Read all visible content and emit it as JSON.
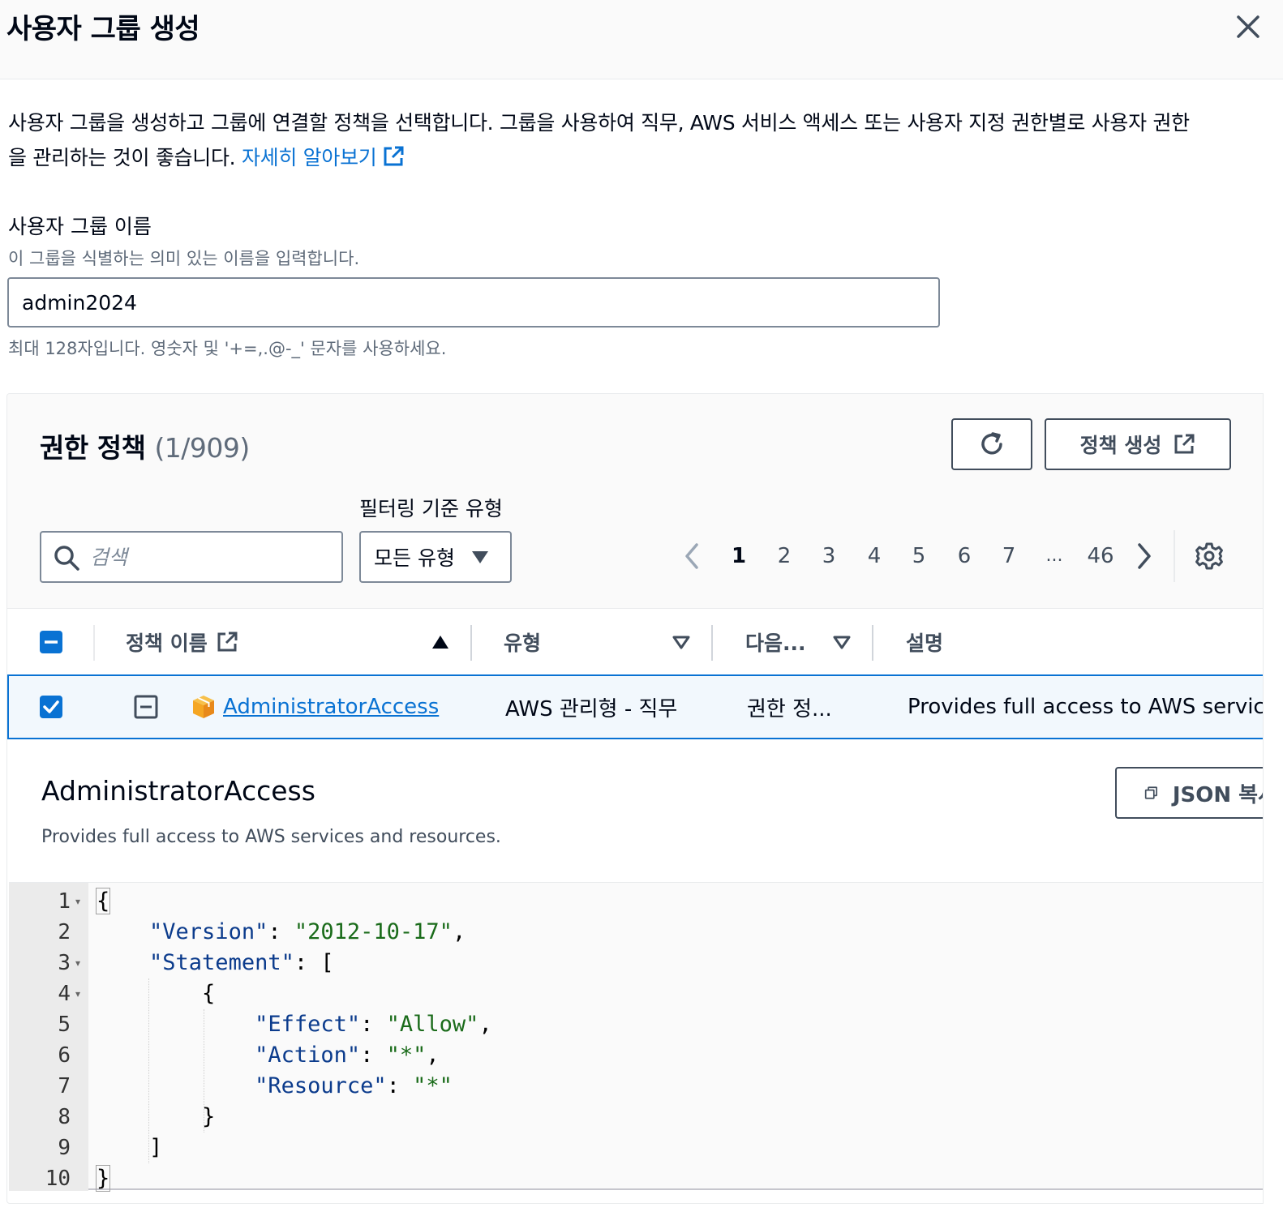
{
  "modal": {
    "title": "사용자 그룹 생성",
    "intro_line1": "사용자 그룹을 생성하고 그룹에 연결할 정책을 선택합니다. 그룹을 사용하여 직무, AWS 서비스 액세스 또는 사용자 지정 권한별로 사용자 권한",
    "intro_line2": "을 관리하는 것이 좋습니다. ",
    "learn_more": "자세히 알아보기"
  },
  "group_name": {
    "label": "사용자 그룹 이름",
    "description": "이 그룹을 식별하는 의미 있는 이름을 입력합니다.",
    "value": "admin2024",
    "constraint": "최대 128자입니다. 영숫자 및 '+=,.@-_' 문자를 사용하세요."
  },
  "policies": {
    "title": "권한 정책",
    "count": "(1/909)",
    "create_button": "정책 생성",
    "filter_label": "필터링 기준 유형",
    "search_placeholder": "검색",
    "type_select": "모든 유형",
    "pages": [
      "1",
      "2",
      "3",
      "4",
      "5",
      "6",
      "7",
      "...",
      "46"
    ],
    "current_page": "1",
    "columns": {
      "name": "정책 이름",
      "type": "유형",
      "used_as": "다음...",
      "description": "설명"
    },
    "rows": [
      {
        "name": "AdministratorAccess",
        "type": "AWS 관리형 - 직무",
        "used_as": "권한 정...",
        "description": "Provides full access to AWS services and resources."
      }
    ]
  },
  "detail": {
    "name": "AdministratorAccess",
    "description": "Provides full access to AWS services and resources.",
    "copy_button": "JSON 복사",
    "line_numbers": [
      "1",
      "2",
      "3",
      "4",
      "5",
      "6",
      "7",
      "8",
      "9",
      "10"
    ],
    "json": {
      "version_key": "\"Version\"",
      "version_value": "\"2012-10-17\"",
      "statement_key": "\"Statement\"",
      "effect_key": "\"Effect\"",
      "effect_value": "\"Allow\"",
      "action_key": "\"Action\"",
      "action_value": "\"*\"",
      "resource_key": "\"Resource\"",
      "resource_value": "\"*\""
    }
  },
  "colors": {
    "link": "#0972d3",
    "selected_row_bg": "#f2f8fd",
    "header_bg": "#fafafa",
    "checkbox": "#0972d3",
    "policy_icon": "#f5a623"
  }
}
